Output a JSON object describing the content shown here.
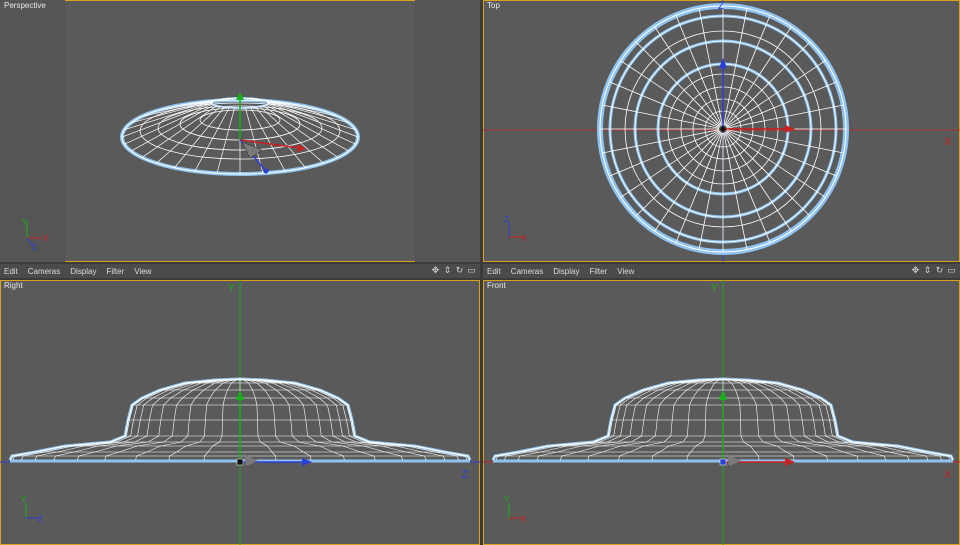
{
  "viewports": {
    "perspective": {
      "label": "Perspective"
    },
    "top": {
      "label": "Top"
    },
    "right": {
      "label": "Right"
    },
    "front": {
      "label": "Front"
    }
  },
  "menu": [
    "Edit",
    "Cameras",
    "Display",
    "Filter",
    "View"
  ],
  "nav_icons": [
    "move-icon",
    "zoom-icon",
    "rotate-icon",
    "maximize-icon"
  ],
  "axis_labels": {
    "x": "X",
    "y": "Y",
    "z": "Z"
  },
  "colors": {
    "viewport_bg": "#5a5a5a",
    "active_border": "#d9a321",
    "wire": "#ffffff",
    "wire_glow": "#8fc4f2",
    "axis_x": "#c92020",
    "axis_y": "#18b018",
    "axis_z": "#2a3fd6"
  }
}
